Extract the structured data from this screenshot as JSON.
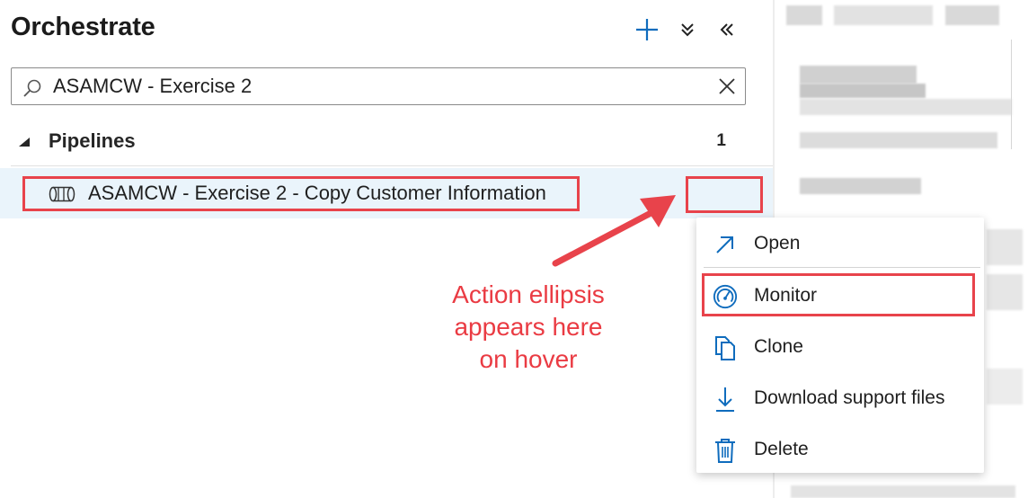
{
  "header": {
    "title": "Orchestrate",
    "add_icon": "plus-icon",
    "collapse_all_icon": "double-chevron-down-icon",
    "collapse_pane_icon": "double-chevron-left-icon"
  },
  "search": {
    "value": "ASAMCW - Exercise 2",
    "search_icon": "search-icon",
    "clear_icon": "close-icon"
  },
  "section": {
    "label": "Pipelines",
    "count": "1",
    "caret_icon": "caret-down-icon"
  },
  "pipeline": {
    "label": "ASAMCW - Exercise 2 - Copy Customer Information",
    "icon": "pipeline-icon"
  },
  "context_menu": {
    "items": [
      {
        "label": "Open",
        "icon": "open-arrow-icon"
      },
      {
        "label": "Monitor",
        "icon": "gauge-icon"
      },
      {
        "label": "Clone",
        "icon": "copy-icon"
      },
      {
        "label": "Download support files",
        "icon": "download-icon"
      },
      {
        "label": "Delete",
        "icon": "trash-icon"
      }
    ]
  },
  "annotation": {
    "lines": [
      "Action ellipsis",
      "appears here",
      "on hover"
    ]
  },
  "colors": {
    "accent": "#0f6cbd",
    "highlight": "#e8434b",
    "annotation_text": "#ea3b43",
    "row_hover": "#eaf4fb"
  }
}
